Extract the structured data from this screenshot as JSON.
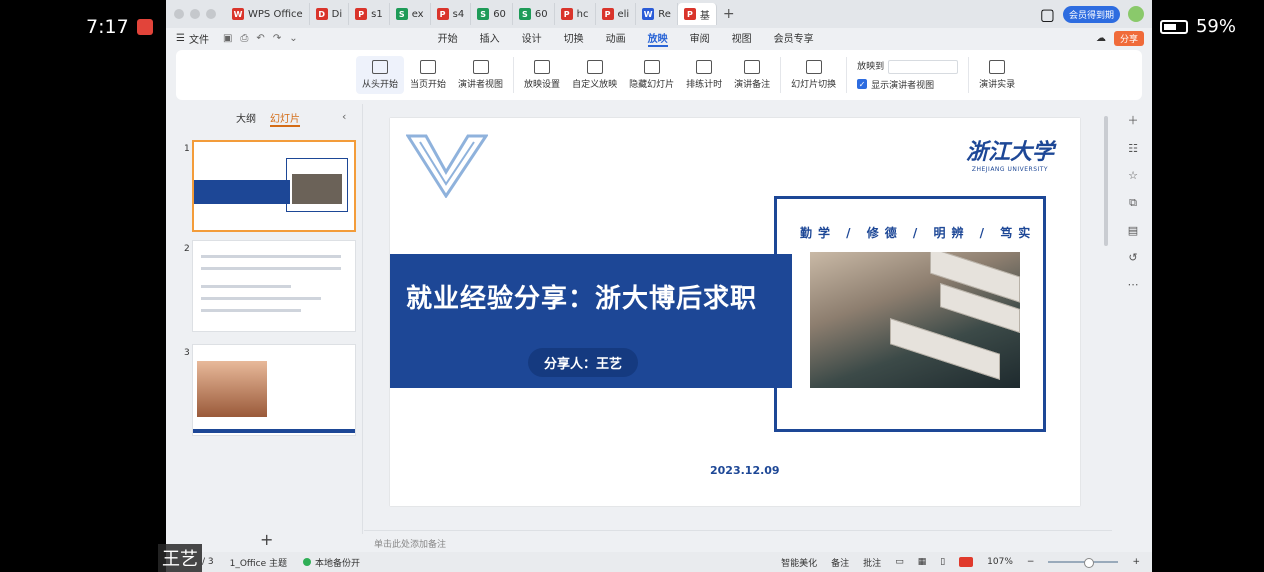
{
  "status_bar": {
    "time": "7:17",
    "battery_pct": "59%"
  },
  "tabs": [
    {
      "label": "WPS Office",
      "icon": "wps",
      "color": "#d9342b"
    },
    {
      "label": "Di",
      "icon": "doc-d",
      "color": "#d9342b"
    },
    {
      "label": "s1",
      "icon": "p",
      "color": "#d9342b"
    },
    {
      "label": "ex",
      "icon": "s",
      "color": "#1e9b58"
    },
    {
      "label": "s4",
      "icon": "p",
      "color": "#d9342b"
    },
    {
      "label": "60",
      "icon": "s",
      "color": "#1e9b58"
    },
    {
      "label": "60",
      "icon": "s",
      "color": "#1e9b58"
    },
    {
      "label": "hc",
      "icon": "p",
      "color": "#d9342b"
    },
    {
      "label": "eli",
      "icon": "p",
      "color": "#d9342b"
    },
    {
      "label": "Re",
      "icon": "w",
      "color": "#2a5bd7"
    },
    {
      "label": "基",
      "icon": "p",
      "color": "#d9342b",
      "active": true
    }
  ],
  "tab_letters": {
    "wps": "W",
    "doc-d": "D",
    "p": "P",
    "s": "S",
    "w": "W"
  },
  "header_right": {
    "vip": "会员得到期",
    "share": "分享"
  },
  "menu": {
    "file": "文件",
    "items": [
      "开始",
      "插入",
      "设计",
      "切换",
      "动画",
      "放映",
      "审阅",
      "视图",
      "会员专享"
    ],
    "active_index": 5
  },
  "ribbon": {
    "buttons": [
      {
        "label": "从头开始",
        "name": "from-start-button",
        "active": true
      },
      {
        "label": "当页开始",
        "name": "from-current-button"
      },
      {
        "label": "演讲者视图",
        "name": "presenter-view-button"
      },
      {
        "label": "放映设置",
        "name": "show-settings-button",
        "dropdown": true
      },
      {
        "label": "自定义放映",
        "name": "custom-show-button"
      },
      {
        "label": "隐藏幻灯片",
        "name": "hide-slide-button"
      },
      {
        "label": "排练计时",
        "name": "rehearse-timing-button",
        "dropdown": true
      },
      {
        "label": "演讲备注",
        "name": "speaker-notes-button"
      },
      {
        "label": "幻灯片切换",
        "name": "slide-switch-button"
      }
    ],
    "show_to_label": "放映到",
    "show_presenter_view": "显示演讲者视图",
    "record_label": "演讲实录"
  },
  "left_panel": {
    "outline_tab": "大纲",
    "slides_tab": "幻灯片",
    "thumbs": [
      "1",
      "2",
      "3"
    ]
  },
  "slide": {
    "title": "就业经验分享：浙大博后求职",
    "presenter": "分享人：王艺",
    "motto": "勤学 / 修德 / 明辨 / 笃实",
    "date": "2023.12.09",
    "logo_cn": "浙江大学",
    "logo_en": "ZHEJIANG UNIVERSITY",
    "brand_color": "#1d4796"
  },
  "notes_placeholder": "单击此处添加备注",
  "statusbar": {
    "page": "/ 3",
    "theme": "1_Office 主题",
    "saved": "本地备份开",
    "beautify": "智能美化",
    "notes": "备注",
    "comments": "批注",
    "zoom": "107%"
  },
  "watermark_name": "王艺"
}
